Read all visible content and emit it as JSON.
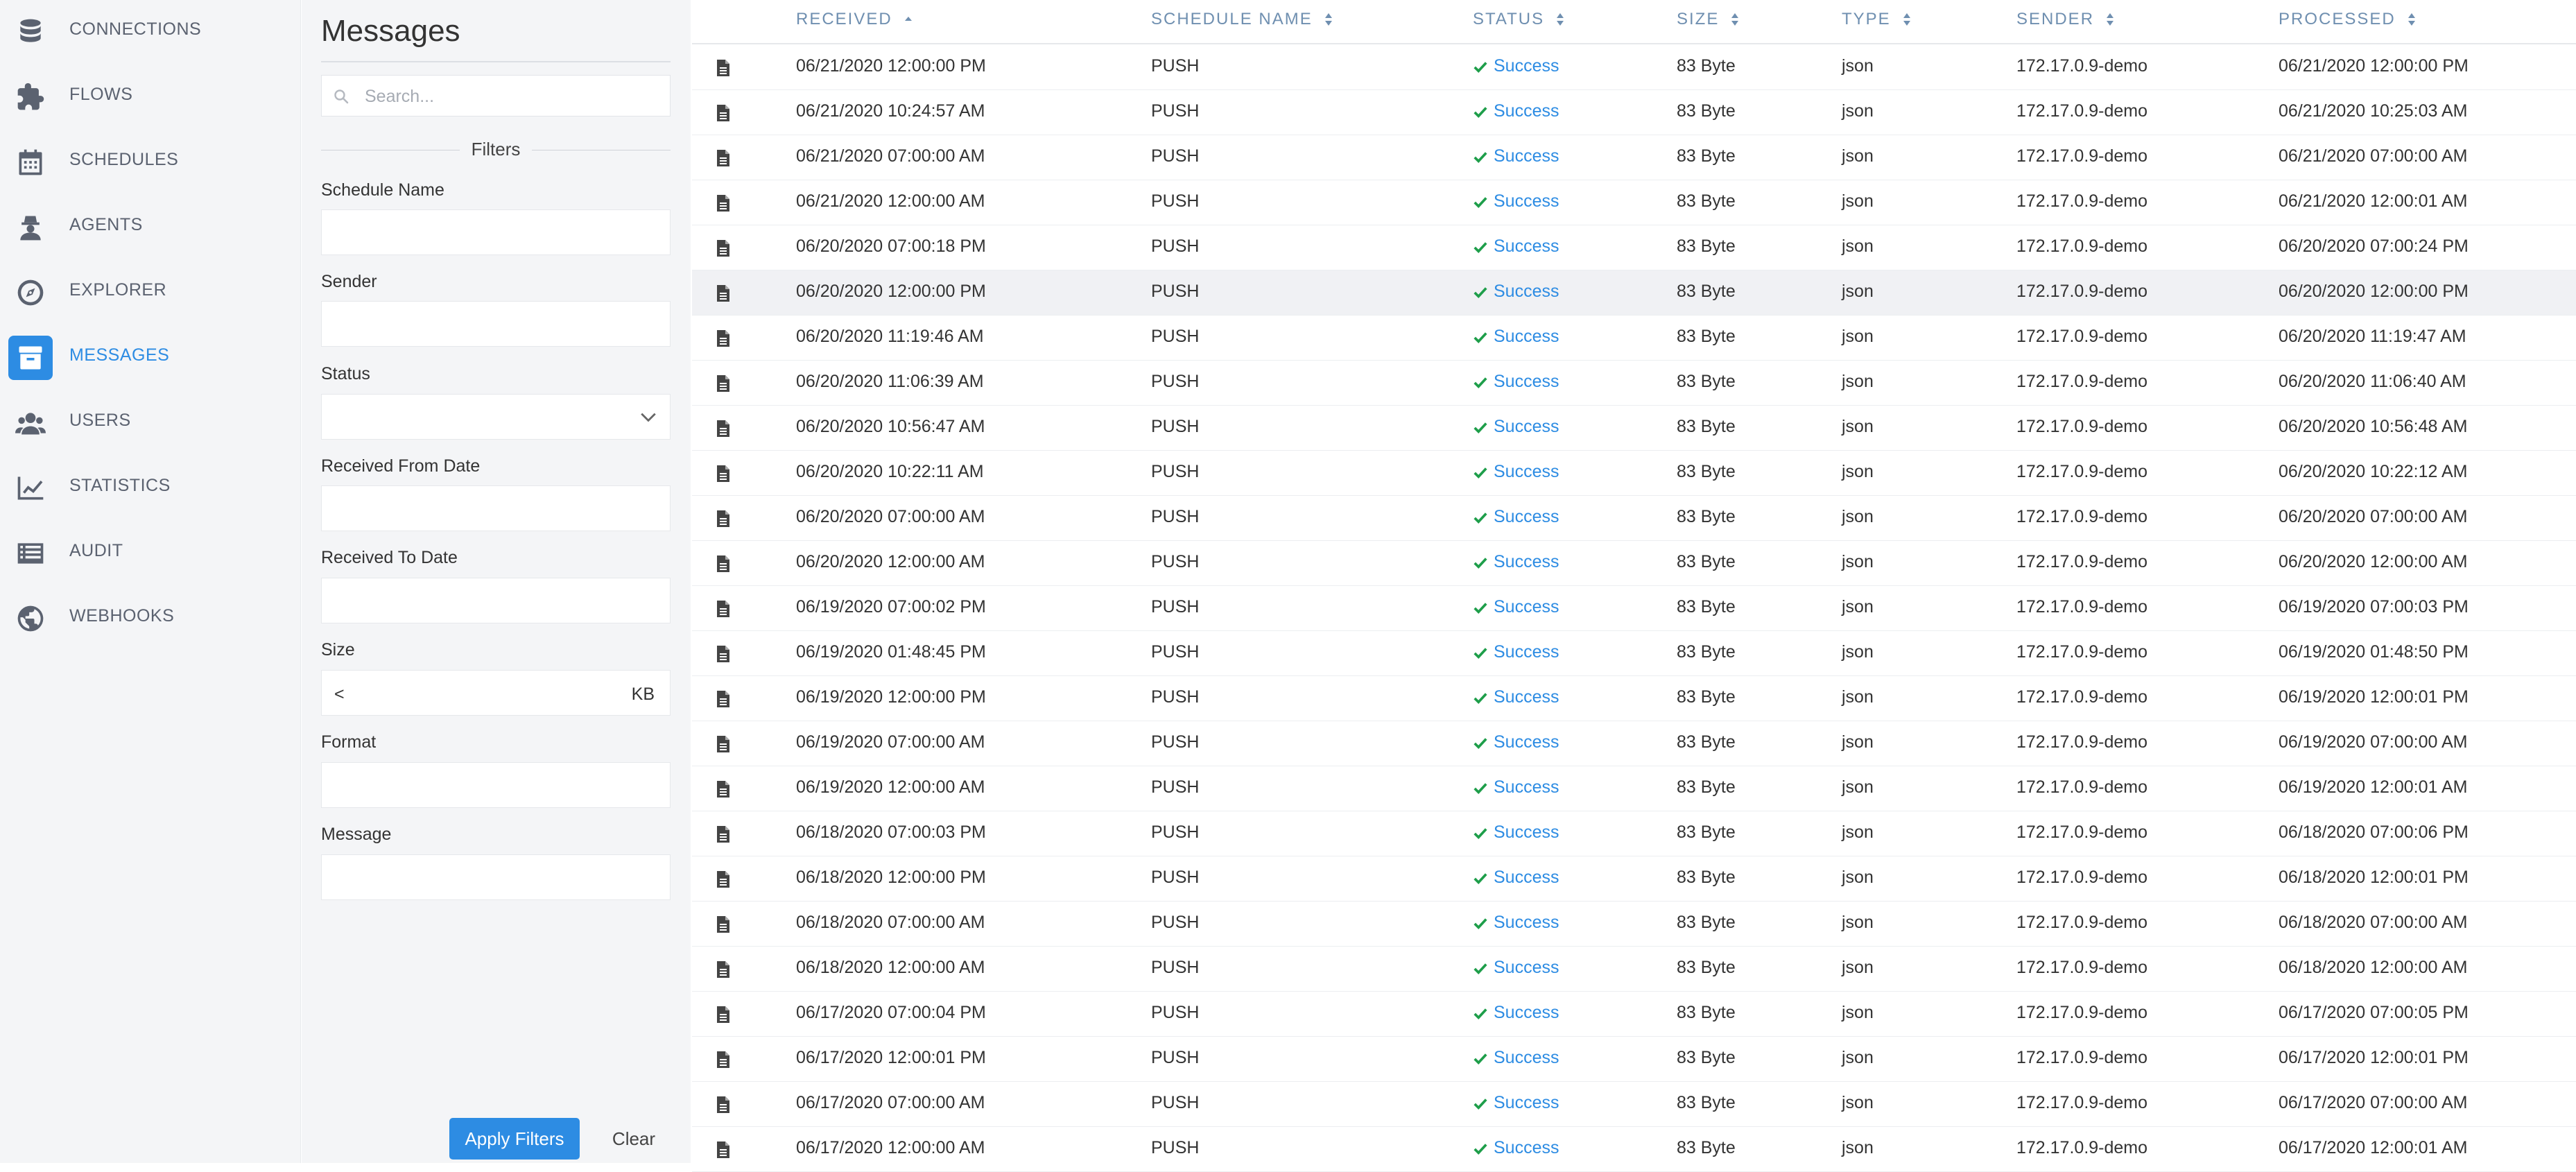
{
  "nav": {
    "items": [
      {
        "label": "CONNECTIONS",
        "icon": "database-icon"
      },
      {
        "label": "FLOWS",
        "icon": "puzzle-icon"
      },
      {
        "label": "SCHEDULES",
        "icon": "calendar-icon"
      },
      {
        "label": "AGENTS",
        "icon": "agent-icon"
      },
      {
        "label": "EXPLORER",
        "icon": "compass-icon"
      },
      {
        "label": "MESSAGES",
        "icon": "archive-icon",
        "active": true
      },
      {
        "label": "USERS",
        "icon": "users-icon"
      },
      {
        "label": "STATISTICS",
        "icon": "line-chart-icon"
      },
      {
        "label": "AUDIT",
        "icon": "list-icon"
      },
      {
        "label": "WEBHOOKS",
        "icon": "globe-icon"
      }
    ]
  },
  "filters": {
    "title": "Messages",
    "search_placeholder": "Search...",
    "heading": "Filters",
    "labels": {
      "schedule_name": "Schedule Name",
      "sender": "Sender",
      "status": "Status",
      "received_from": "Received From Date",
      "received_to": "Received To Date",
      "size": "Size",
      "format": "Format",
      "message": "Message"
    },
    "size_operator": "<",
    "size_unit": "KB",
    "apply_label": "Apply Filters",
    "clear_label": "Clear"
  },
  "table": {
    "columns": [
      "RECEIVED",
      "SCHEDULE NAME",
      "STATUS",
      "SIZE",
      "TYPE",
      "SENDER",
      "PROCESSED"
    ],
    "sorted_column": "RECEIVED",
    "sort_direction": "ascending",
    "rows": [
      {
        "received": "06/21/2020 12:00:00 PM",
        "schedule": "PUSH",
        "status": "Success",
        "size": "83 Byte",
        "type": "json",
        "sender": "172.17.0.9-demo",
        "processed": "06/21/2020 12:00:00 PM"
      },
      {
        "received": "06/21/2020 10:24:57 AM",
        "schedule": "PUSH",
        "status": "Success",
        "size": "83 Byte",
        "type": "json",
        "sender": "172.17.0.9-demo",
        "processed": "06/21/2020 10:25:03 AM"
      },
      {
        "received": "06/21/2020 07:00:00 AM",
        "schedule": "PUSH",
        "status": "Success",
        "size": "83 Byte",
        "type": "json",
        "sender": "172.17.0.9-demo",
        "processed": "06/21/2020 07:00:00 AM"
      },
      {
        "received": "06/21/2020 12:00:00 AM",
        "schedule": "PUSH",
        "status": "Success",
        "size": "83 Byte",
        "type": "json",
        "sender": "172.17.0.9-demo",
        "processed": "06/21/2020 12:00:01 AM"
      },
      {
        "received": "06/20/2020 07:00:18 PM",
        "schedule": "PUSH",
        "status": "Success",
        "size": "83 Byte",
        "type": "json",
        "sender": "172.17.0.9-demo",
        "processed": "06/20/2020 07:00:24 PM"
      },
      {
        "received": "06/20/2020 12:00:00 PM",
        "schedule": "PUSH",
        "status": "Success",
        "size": "83 Byte",
        "type": "json",
        "sender": "172.17.0.9-demo",
        "processed": "06/20/2020 12:00:00 PM"
      },
      {
        "received": "06/20/2020 11:19:46 AM",
        "schedule": "PUSH",
        "status": "Success",
        "size": "83 Byte",
        "type": "json",
        "sender": "172.17.0.9-demo",
        "processed": "06/20/2020 11:19:47 AM"
      },
      {
        "received": "06/20/2020 11:06:39 AM",
        "schedule": "PUSH",
        "status": "Success",
        "size": "83 Byte",
        "type": "json",
        "sender": "172.17.0.9-demo",
        "processed": "06/20/2020 11:06:40 AM"
      },
      {
        "received": "06/20/2020 10:56:47 AM",
        "schedule": "PUSH",
        "status": "Success",
        "size": "83 Byte",
        "type": "json",
        "sender": "172.17.0.9-demo",
        "processed": "06/20/2020 10:56:48 AM"
      },
      {
        "received": "06/20/2020 10:22:11 AM",
        "schedule": "PUSH",
        "status": "Success",
        "size": "83 Byte",
        "type": "json",
        "sender": "172.17.0.9-demo",
        "processed": "06/20/2020 10:22:12 AM"
      },
      {
        "received": "06/20/2020 07:00:00 AM",
        "schedule": "PUSH",
        "status": "Success",
        "size": "83 Byte",
        "type": "json",
        "sender": "172.17.0.9-demo",
        "processed": "06/20/2020 07:00:00 AM"
      },
      {
        "received": "06/20/2020 12:00:00 AM",
        "schedule": "PUSH",
        "status": "Success",
        "size": "83 Byte",
        "type": "json",
        "sender": "172.17.0.9-demo",
        "processed": "06/20/2020 12:00:00 AM"
      },
      {
        "received": "06/19/2020 07:00:02 PM",
        "schedule": "PUSH",
        "status": "Success",
        "size": "83 Byte",
        "type": "json",
        "sender": "172.17.0.9-demo",
        "processed": "06/19/2020 07:00:03 PM"
      },
      {
        "received": "06/19/2020 01:48:45 PM",
        "schedule": "PUSH",
        "status": "Success",
        "size": "83 Byte",
        "type": "json",
        "sender": "172.17.0.9-demo",
        "processed": "06/19/2020 01:48:50 PM"
      },
      {
        "received": "06/19/2020 12:00:00 PM",
        "schedule": "PUSH",
        "status": "Success",
        "size": "83 Byte",
        "type": "json",
        "sender": "172.17.0.9-demo",
        "processed": "06/19/2020 12:00:01 PM"
      },
      {
        "received": "06/19/2020 07:00:00 AM",
        "schedule": "PUSH",
        "status": "Success",
        "size": "83 Byte",
        "type": "json",
        "sender": "172.17.0.9-demo",
        "processed": "06/19/2020 07:00:00 AM"
      },
      {
        "received": "06/19/2020 12:00:00 AM",
        "schedule": "PUSH",
        "status": "Success",
        "size": "83 Byte",
        "type": "json",
        "sender": "172.17.0.9-demo",
        "processed": "06/19/2020 12:00:01 AM"
      },
      {
        "received": "06/18/2020 07:00:03 PM",
        "schedule": "PUSH",
        "status": "Success",
        "size": "83 Byte",
        "type": "json",
        "sender": "172.17.0.9-demo",
        "processed": "06/18/2020 07:00:06 PM"
      },
      {
        "received": "06/18/2020 12:00:00 PM",
        "schedule": "PUSH",
        "status": "Success",
        "size": "83 Byte",
        "type": "json",
        "sender": "172.17.0.9-demo",
        "processed": "06/18/2020 12:00:01 PM"
      },
      {
        "received": "06/18/2020 07:00:00 AM",
        "schedule": "PUSH",
        "status": "Success",
        "size": "83 Byte",
        "type": "json",
        "sender": "172.17.0.9-demo",
        "processed": "06/18/2020 07:00:00 AM"
      },
      {
        "received": "06/18/2020 12:00:00 AM",
        "schedule": "PUSH",
        "status": "Success",
        "size": "83 Byte",
        "type": "json",
        "sender": "172.17.0.9-demo",
        "processed": "06/18/2020 12:00:00 AM"
      },
      {
        "received": "06/17/2020 07:00:04 PM",
        "schedule": "PUSH",
        "status": "Success",
        "size": "83 Byte",
        "type": "json",
        "sender": "172.17.0.9-demo",
        "processed": "06/17/2020 07:00:05 PM"
      },
      {
        "received": "06/17/2020 12:00:01 PM",
        "schedule": "PUSH",
        "status": "Success",
        "size": "83 Byte",
        "type": "json",
        "sender": "172.17.0.9-demo",
        "processed": "06/17/2020 12:00:01 PM"
      },
      {
        "received": "06/17/2020 07:00:00 AM",
        "schedule": "PUSH",
        "status": "Success",
        "size": "83 Byte",
        "type": "json",
        "sender": "172.17.0.9-demo",
        "processed": "06/17/2020 07:00:00 AM"
      },
      {
        "received": "06/17/2020 12:00:00 AM",
        "schedule": "PUSH",
        "status": "Success",
        "size": "83 Byte",
        "type": "json",
        "sender": "172.17.0.9-demo",
        "processed": "06/17/2020 12:00:01 AM"
      }
    ]
  },
  "colors": {
    "accent": "#2d8ce3",
    "nav_bg": "#f4f5f7",
    "header_text": "#6f8fb0",
    "row_hover": "#f0f1f4"
  }
}
